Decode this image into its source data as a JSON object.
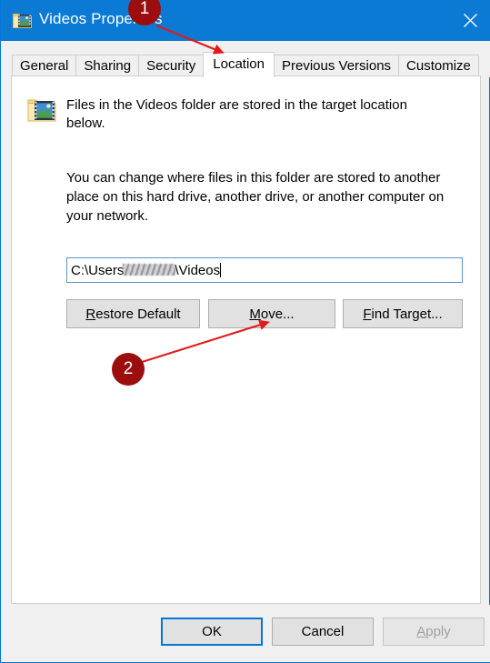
{
  "window": {
    "title": "Videos Properties",
    "title_icon": "videos-folder-icon",
    "close_icon": "close-icon",
    "accent_color": "#0078d7",
    "titlebar_color": "#0b7ad4"
  },
  "tabs": [
    {
      "label": "General",
      "active": false
    },
    {
      "label": "Sharing",
      "active": false
    },
    {
      "label": "Security",
      "active": false
    },
    {
      "label": "Location",
      "active": true
    },
    {
      "label": "Previous Versions",
      "active": false
    },
    {
      "label": "Customize",
      "active": false
    }
  ],
  "panel": {
    "header_icon": "videos-folder-icon",
    "header_text": "Files in the Videos folder are stored in the target location below.",
    "body_text": "You can change where files in this folder are stored to another place on this hard drive, another drive, or another computer on your network.",
    "path_field": {
      "prefix": "C:\\Users",
      "redacted": "redacted-username",
      "suffix": "\\Videos",
      "value": "C:\\Users\\[redacted]\\Videos",
      "has_caret": true
    },
    "buttons": [
      {
        "label": "Restore Default",
        "accel": "R",
        "rest": "estore Default",
        "enabled": true
      },
      {
        "label": "Move...",
        "accel": "M",
        "rest": "ove...",
        "enabled": true
      },
      {
        "label": "Find Target...",
        "accel": "F",
        "rest": "ind Target...",
        "enabled": true
      }
    ]
  },
  "footer": {
    "ok": "OK",
    "cancel": "Cancel",
    "apply_accel": "A",
    "apply_rest": "pply",
    "apply_label": "Apply",
    "apply_enabled": false,
    "default_button": "OK"
  },
  "annotations": {
    "marker_color": "#9c0d0d",
    "arrow_color": "#e01b1b",
    "markers": [
      {
        "number": "1",
        "target": "Location tab"
      },
      {
        "number": "2",
        "target": "Move... button"
      }
    ]
  }
}
